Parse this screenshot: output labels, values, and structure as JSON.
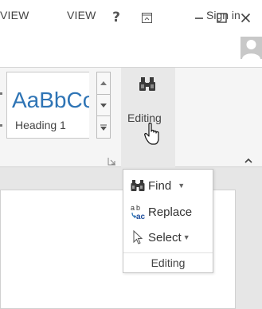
{
  "window": {
    "help_label": "?",
    "icons": [
      "ribbon-display-options-icon",
      "minimize-icon",
      "maximize-icon",
      "close-icon"
    ]
  },
  "tabs": [
    {
      "label": "VIEW"
    },
    {
      "label": "VIEW"
    }
  ],
  "account": {
    "sign_in_label": "Sign in"
  },
  "styles": {
    "sample_text": "AaBbCc",
    "style_name": "Heading 1"
  },
  "editing": {
    "button_label": "Editing",
    "group_label": "Editing",
    "menu": [
      {
        "label": "Find",
        "icon": "binoculars-icon",
        "has_arrow": true
      },
      {
        "label": "Replace",
        "icon": "replace-ab-ac-icon",
        "has_arrow": false
      },
      {
        "label": "Select",
        "icon": "select-cursor-icon",
        "has_arrow": true
      }
    ]
  },
  "colors": {
    "accent": "#2e74b5",
    "ribbon": "#f5f5f5",
    "window": "#e6e6e6"
  }
}
